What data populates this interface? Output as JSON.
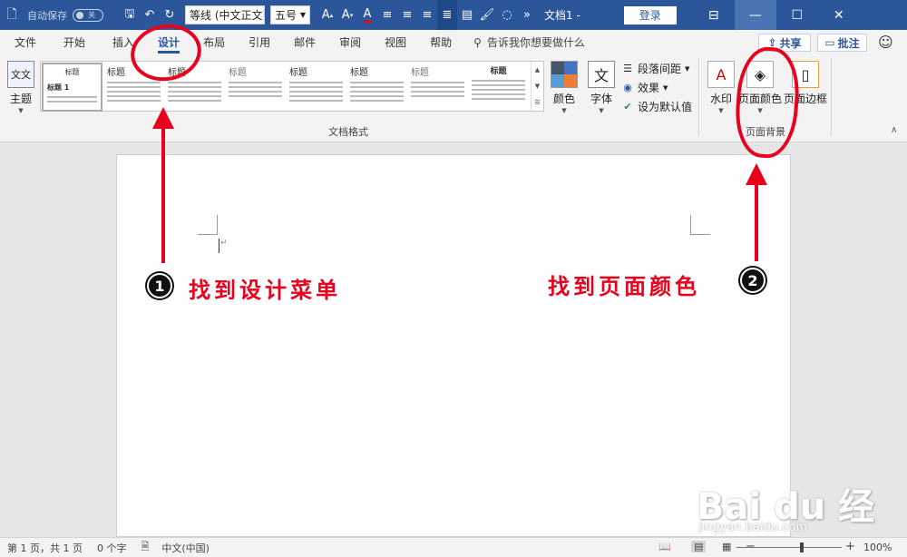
{
  "titlebar": {
    "autosave_label": "自动保存",
    "autosave_state": "关",
    "font_name": "等线 (中文正文)",
    "font_size": "五号",
    "doc_title": "文档1 -",
    "login_label": "登录"
  },
  "tabs": [
    {
      "label": "文件"
    },
    {
      "label": "开始"
    },
    {
      "label": "插入"
    },
    {
      "label": "设计"
    },
    {
      "label": "布局"
    },
    {
      "label": "引用"
    },
    {
      "label": "邮件"
    },
    {
      "label": "审阅"
    },
    {
      "label": "视图"
    },
    {
      "label": "帮助"
    }
  ],
  "active_tab": "设计",
  "tell_me": "告诉我你想要做什么",
  "share_label": "共享",
  "comment_label": "批注",
  "ribbon": {
    "theme_label": "主题",
    "gallery": [
      {
        "title": "标题"
      },
      {
        "title": "标题"
      },
      {
        "title": "标题"
      },
      {
        "title": "标题"
      },
      {
        "title": "标题"
      },
      {
        "title": "标题"
      },
      {
        "title": "标题"
      },
      {
        "title": "标题"
      }
    ],
    "gallery_first_heading": "标题 1",
    "doc_format_group": "文档格式",
    "colors_label": "颜色",
    "fonts_label": "字体",
    "fonts_glyph": "文",
    "paragraph_spacing": "段落间距",
    "effects": "效果",
    "set_default": "设为默认值",
    "watermark_label": "水印",
    "page_color_label": "页面颜色",
    "page_borders_label": "页面边框",
    "page_background_group": "页面背景"
  },
  "annotations": {
    "step1_number": "1",
    "step1_text": "找到设计菜单",
    "step2_number": "2",
    "step2_text": "找到页面颜色",
    "arrow_color": "#e8001c"
  },
  "watermark": {
    "brand": "Bai du 经验",
    "url": "jingyan.baidu.com"
  },
  "statusbar": {
    "page_info": "第 1 页，共 1 页",
    "word_count": "0 个字",
    "language": "中文(中国)",
    "zoom": "100%"
  },
  "colors": {
    "title_bar": "#2b579a",
    "annotation_red": "#e8001c"
  }
}
